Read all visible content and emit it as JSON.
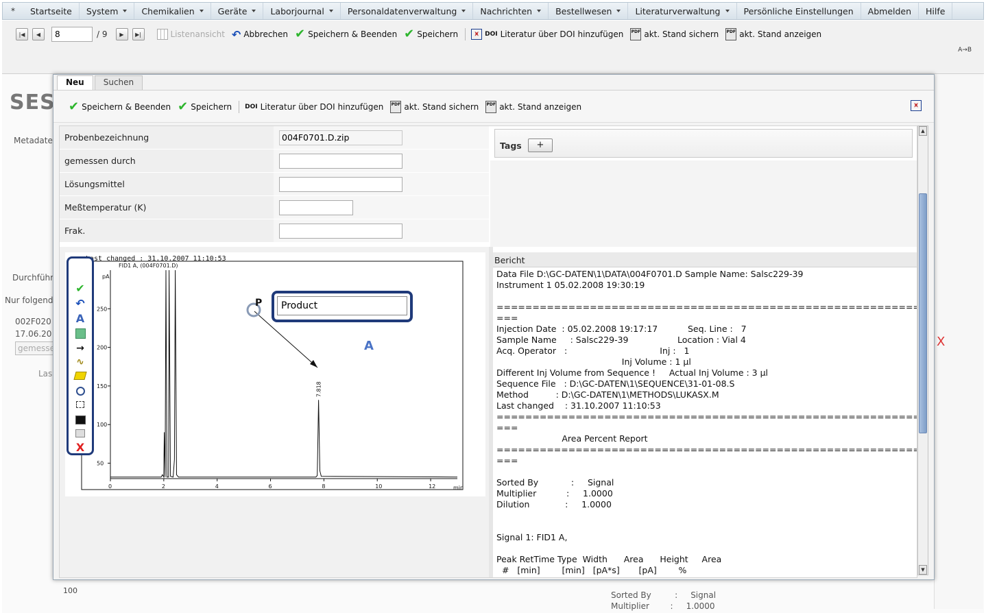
{
  "menu": {
    "star": "*",
    "items": [
      {
        "label": "Startseite",
        "caret": false
      },
      {
        "label": "System",
        "caret": true
      },
      {
        "label": "Chemikalien",
        "caret": true
      },
      {
        "label": "Geräte",
        "caret": true
      },
      {
        "label": "Laborjournal",
        "caret": true
      },
      {
        "label": "Personaldatenverwaltung",
        "caret": true
      },
      {
        "label": "Nachrichten",
        "caret": true
      },
      {
        "label": "Bestellwesen",
        "caret": true
      },
      {
        "label": "Literaturverwaltung",
        "caret": true
      },
      {
        "label": "Persönliche Einstellungen",
        "caret": false
      },
      {
        "label": "Abmelden",
        "caret": false
      },
      {
        "label": "Hilfe",
        "caret": false
      }
    ]
  },
  "toolbar": {
    "page_value": "8",
    "page_total": "/ 9",
    "listenansicht": "Listenansicht",
    "abbrechen": "Abbrechen",
    "speichern_beenden": "Speichern & Beenden",
    "speichern": "Speichern",
    "doi_prefix": "DOI",
    "doi_label": "Literatur über DOI hinzufügen",
    "stand_sichern": "akt. Stand sichern",
    "stand_anzeigen": "akt. Stand anzeigen",
    "pdf_tag": "PDF",
    "arrows": "A→B"
  },
  "background": {
    "title": "SES",
    "metadaten": "Metadaten",
    "durchfuehrung": "Durchführ",
    "nur_folgend": "Nur folgend",
    "row1": "002F020",
    "row2": "17.06.20",
    "placeholder": "gemesse",
    "las": "Las",
    "axis_100": "100",
    "sorted_text": "Sorted By         :     Signal\nMultiplier        :     1.0000",
    "close": "X"
  },
  "modal": {
    "tabs": [
      {
        "label": "Neu",
        "active": true
      },
      {
        "label": "Suchen",
        "active": false
      }
    ],
    "toolbar": {
      "speichern_beenden": "Speichern & Beenden",
      "speichern": "Speichern",
      "doi_prefix": "DOI",
      "doi_label": "Literatur über DOI hinzufügen",
      "stand_sichern": "akt. Stand sichern",
      "stand_anzeigen": "akt. Stand anzeigen",
      "pdf_tag": "PDF"
    },
    "form": {
      "probenbezeichnung_label": "Probenbezeichnung",
      "probenbezeichnung_value": "004F0701.D.zip",
      "gemessen_label": "gemessen durch",
      "gemessen_value": "",
      "loesungsmittel_label": "Lösungsmittel",
      "loesungsmittel_value": "",
      "temperatur_label": "Meßtemperatur (K)",
      "temperatur_value": "",
      "frak_label": "Frak.",
      "frak_value": ""
    },
    "tags": {
      "label": "Tags",
      "add": "+"
    },
    "bericht": {
      "heading": "Bericht",
      "text": "Data File D:\\GC-DATEN\\1\\DATA\\004F0701.D Sample Name: Salsc229-39\nInstrument 1 05.02.2008 19:30:19\n\n=================================================================================\n===\nInjection Date  : 05.02.2008 19:17:17           Seq. Line :   7\nSample Name     : Salsc229-39                  Location : Vial 4\nAcq. Operator   :                                  Inj :   1\n                                              Inj Volume : 1 µl\nDifferent Inj Volume from Sequence !     Actual Inj Volume : 3 µl\nSequence File   : D:\\GC-DATEN\\1\\SEQUENCE\\31-01-08.S\nMethod          : D:\\GC-DATEN\\1\\METHODS\\LUKASX.M\nLast changed    : 31.10.2007 11:10:53\n=================================================================================\n===\n                        Area Percent Report\n=================================================================================\n===\n\nSorted By            :     Signal\nMultiplier           :     1.0000\nDilution             :     1.0000\n\n\nSignal 1: FID1 A,\n\nPeak RetTime Type  Width      Area      Height     Area\n  #   [min]        [min]   [pA*s]       [pA]        %"
    },
    "annotation": {
      "callout_value": "Product",
      "label_fragment": "P",
      "text_tool_glyph": "A",
      "close_glyph": "X"
    }
  },
  "chart_data": {
    "type": "line",
    "title": "",
    "header_text": "Last changed    : 31.10.2007 11:10:53",
    "series_label": "FID1 A, (004F0701.D)",
    "ylabel": "pA",
    "xlabel": "min",
    "xlim": [
      0,
      13
    ],
    "ylim": [
      30,
      300
    ],
    "xticks": [
      0,
      2,
      4,
      6,
      8,
      10,
      12
    ],
    "yticks": [
      50,
      100,
      150,
      200,
      250
    ],
    "grid": false,
    "series": [
      {
        "points": [
          [
            0,
            32
          ],
          [
            1.9,
            32
          ],
          [
            1.95,
            35
          ],
          [
            2.0,
            32
          ],
          [
            2.02,
            90
          ],
          [
            2.05,
            32
          ],
          [
            2.08,
            300
          ],
          [
            2.12,
            32
          ],
          [
            2.18,
            32
          ],
          [
            2.2,
            300
          ],
          [
            2.25,
            33
          ],
          [
            2.35,
            32
          ],
          [
            2.4,
            55
          ],
          [
            2.43,
            300
          ],
          [
            2.48,
            35
          ],
          [
            2.55,
            32
          ],
          [
            7.7,
            32
          ],
          [
            7.75,
            34
          ],
          [
            7.8,
            132
          ],
          [
            7.85,
            40
          ],
          [
            7.9,
            33
          ],
          [
            13,
            32
          ]
        ]
      }
    ],
    "peak_annotations": [
      {
        "x": 7.818,
        "label": "7.818"
      }
    ]
  }
}
